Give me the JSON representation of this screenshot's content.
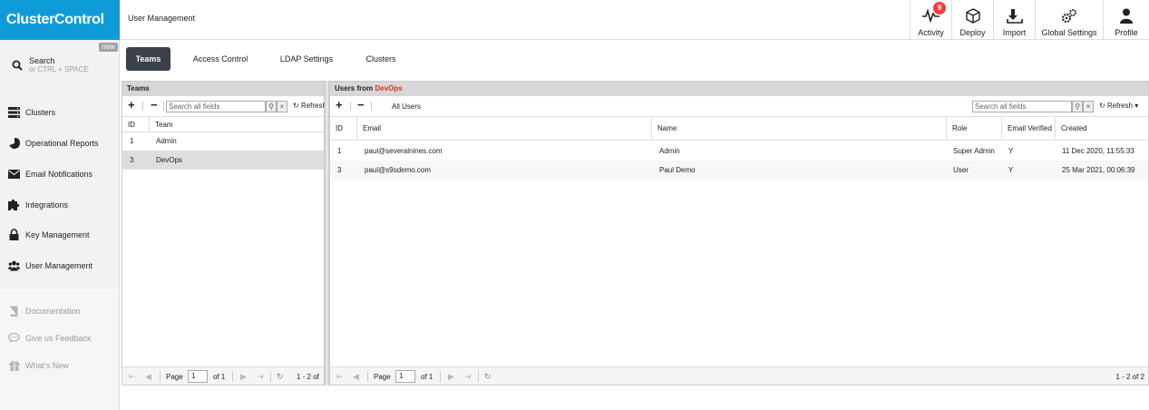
{
  "app": {
    "logo": "ClusterControl"
  },
  "header": {
    "title": "User Management",
    "buttons": [
      {
        "label": "Activity",
        "icon": "activity-icon",
        "badge": "9"
      },
      {
        "label": "Deploy",
        "icon": "deploy-icon"
      },
      {
        "label": "Import",
        "icon": "import-icon"
      },
      {
        "label": "Global Settings",
        "icon": "gears-icon"
      },
      {
        "label": "Profile",
        "icon": "user-icon"
      }
    ]
  },
  "sidebar": {
    "search": {
      "label": "Search",
      "hint": "or CTRL + SPACE",
      "badge": "new"
    },
    "items": [
      {
        "label": "Clusters",
        "icon": "servers-icon"
      },
      {
        "label": "Operational Reports",
        "icon": "pie-chart-icon"
      },
      {
        "label": "Email Notifications",
        "icon": "envelope-icon"
      },
      {
        "label": "Integrations",
        "icon": "puzzle-icon"
      },
      {
        "label": "Key Management",
        "icon": "lock-icon"
      },
      {
        "label": "User Management",
        "icon": "users-icon"
      }
    ],
    "secondary": [
      {
        "label": "Documentation",
        "icon": "book-icon"
      },
      {
        "label": "Give us Feedback",
        "icon": "comment-icon"
      },
      {
        "label": "What's New",
        "icon": "gift-icon"
      }
    ]
  },
  "tabs": [
    {
      "label": "Teams",
      "active": true
    },
    {
      "label": "Access Control"
    },
    {
      "label": "LDAP Settings"
    },
    {
      "label": "Clusters"
    }
  ],
  "teams_panel": {
    "title": "Teams",
    "search_placeholder": "Search all fields",
    "refresh_label": "Refresh",
    "columns": [
      "ID",
      "Team"
    ],
    "rows": [
      {
        "id": "1",
        "team": "Admin"
      },
      {
        "id": "3",
        "team": "DevOps"
      }
    ],
    "pager": {
      "page_label": "Page",
      "page": "1",
      "of_label": "of 1",
      "range": "1 - 2 of"
    }
  },
  "users_panel": {
    "title_prefix": "Users from",
    "title_team": "DevOps",
    "all_users_label": "All Users",
    "search_placeholder": "Search all fields",
    "refresh_label": "Refresh",
    "columns": [
      "ID",
      "Email",
      "Name",
      "Role",
      "Email Verified",
      "Created"
    ],
    "rows": [
      {
        "id": "1",
        "email": "paul@severalnines.com",
        "name": "Admin",
        "role": "Super Admin",
        "verified": "Y",
        "created": "11 Dec 2020, 11:55:33"
      },
      {
        "id": "3",
        "email": "paul@s9sdemo.com",
        "name": "Paul Demo",
        "role": "User",
        "verified": "Y",
        "created": "25 Mar 2021, 00:06:39"
      }
    ],
    "pager": {
      "page_label": "Page",
      "page": "1",
      "of_label": "of 1",
      "range": "1 - 2 of 2"
    }
  },
  "colors": {
    "brand": "#0f9bd7",
    "active_tab": "#3a4149",
    "badge": "#e8413e",
    "highlight": "#d9341f"
  }
}
